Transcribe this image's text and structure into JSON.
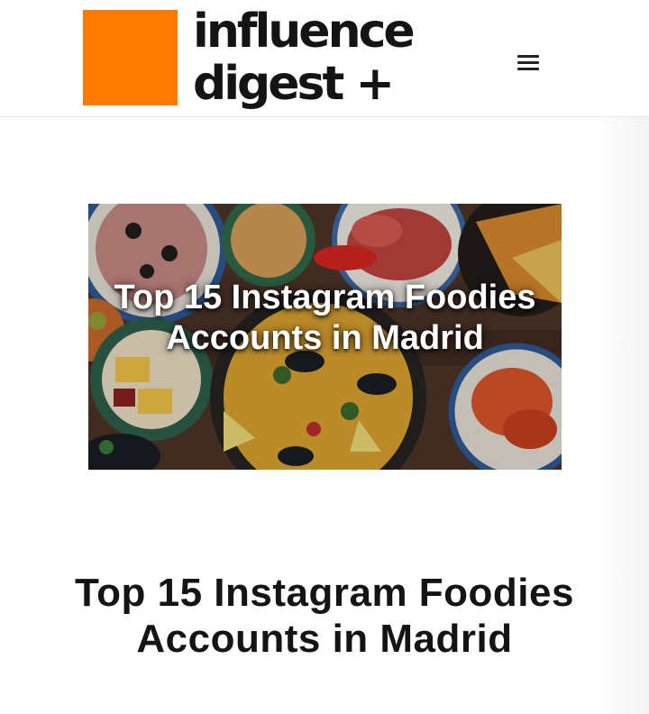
{
  "header": {
    "logo_line1": "influence",
    "logo_line2": "digest +",
    "brand_color": "#ff7a00",
    "menu_icon": "hamburger-menu-icon"
  },
  "featured_image": {
    "overlay_title": "Top 15 Instagram Foodies Accounts in Madrid"
  },
  "article": {
    "title": "Top 15 Instagram Foodies Accounts in Madrid"
  }
}
